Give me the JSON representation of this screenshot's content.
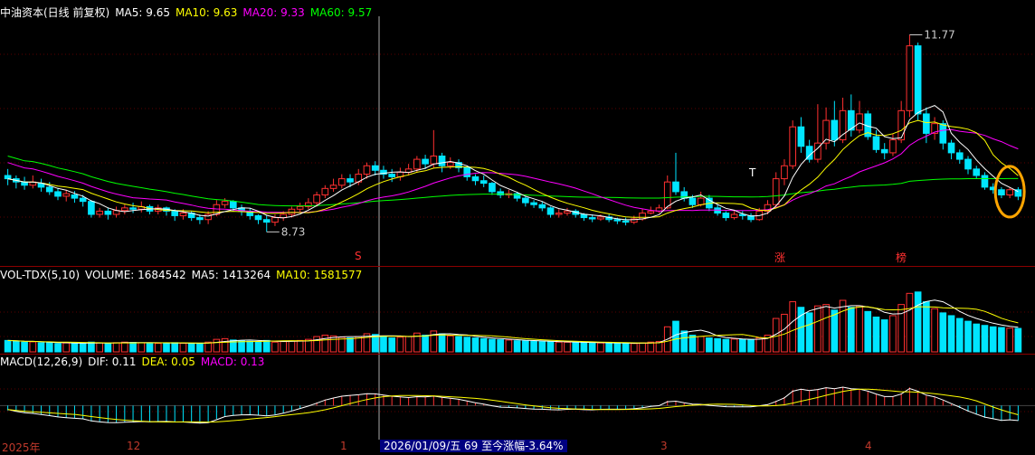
{
  "header_main": {
    "title": "中油资本(日线 前复权)",
    "ma5": "MA5: 9.65",
    "ma10": "MA10: 9.63",
    "ma20": "MA20: 9.33",
    "ma60": "MA60: 9.57"
  },
  "header_vol": {
    "title": "VOL-TDX(5,10)",
    "volume": "VOLUME: 1684542",
    "ma5": "MA5: 1413264",
    "ma10": "MA10: 1581577"
  },
  "header_macd": {
    "title": "MACD(12,26,9)",
    "dif": "DIF: 0.11",
    "dea": "DEA: 0.05",
    "macd": "MACD: 0.13"
  },
  "annotations": {
    "high": "11.77",
    "low": "8.73",
    "marker_s": "S",
    "marker_t": "T",
    "marker_zhang": "涨",
    "marker_bang": "榜"
  },
  "x_axis": {
    "labels": [
      "2025年",
      "12",
      "1",
      "3",
      "4"
    ],
    "date_box": "2026/01/09/五 69 至今涨幅-3.64%"
  },
  "colors": {
    "up": "#ff3030",
    "down": "#00e5ff",
    "ma5": "#ffffff",
    "ma10": "#ffff00",
    "ma20": "#ff00ff",
    "ma60": "#00ff00",
    "highlight": "#ffa500"
  },
  "chart_data": {
    "type": "candlestick",
    "title": "中油资本(日线 前复权)",
    "price_range": [
      8.4,
      12.0
    ],
    "candles": [
      [
        9.6,
        9.55,
        9.7,
        9.45
      ],
      [
        9.55,
        9.5,
        9.6,
        9.4
      ],
      [
        9.5,
        9.45,
        9.58,
        9.38
      ],
      [
        9.45,
        9.5,
        9.6,
        9.4
      ],
      [
        9.48,
        9.42,
        9.55,
        9.35
      ],
      [
        9.42,
        9.35,
        9.5,
        9.3
      ],
      [
        9.35,
        9.28,
        9.4,
        9.22
      ],
      [
        9.28,
        9.32,
        9.38,
        9.2
      ],
      [
        9.3,
        9.25,
        9.36,
        9.18
      ],
      [
        9.25,
        9.2,
        9.3,
        9.12
      ],
      [
        9.2,
        9.0,
        9.22,
        8.95
      ],
      [
        9.0,
        9.05,
        9.1,
        8.95
      ],
      [
        9.05,
        9.0,
        9.1,
        8.92
      ],
      [
        9.0,
        9.06,
        9.12,
        8.95
      ],
      [
        9.06,
        9.1,
        9.15,
        9.0
      ],
      [
        9.1,
        9.08,
        9.18,
        9.02
      ],
      [
        9.08,
        9.12,
        9.2,
        9.03
      ],
      [
        9.12,
        9.05,
        9.15,
        9.0
      ],
      [
        9.05,
        9.1,
        9.15,
        9.0
      ],
      [
        9.1,
        9.05,
        9.12,
        8.98
      ],
      [
        9.05,
        8.98,
        9.08,
        8.9
      ],
      [
        8.98,
        9.02,
        9.08,
        8.92
      ],
      [
        9.02,
        8.95,
        9.05,
        8.9
      ],
      [
        8.95,
        8.92,
        9.0,
        8.85
      ],
      [
        8.92,
        9.0,
        9.05,
        8.85
      ],
      [
        9.0,
        9.15,
        9.22,
        8.97
      ],
      [
        9.15,
        9.2,
        9.25,
        9.1
      ],
      [
        9.2,
        9.1,
        9.22,
        9.05
      ],
      [
        9.1,
        9.05,
        9.15,
        8.98
      ],
      [
        9.05,
        8.98,
        9.1,
        8.92
      ],
      [
        8.98,
        8.92,
        9.0,
        8.85
      ],
      [
        8.92,
        8.88,
        8.98,
        8.73
      ],
      [
        8.88,
        8.95,
        9.0,
        8.82
      ],
      [
        8.95,
        9.0,
        9.05,
        8.9
      ],
      [
        9.0,
        9.08,
        9.12,
        8.95
      ],
      [
        9.08,
        9.12,
        9.18,
        9.03
      ],
      [
        9.12,
        9.18,
        9.25,
        9.08
      ],
      [
        9.18,
        9.3,
        9.35,
        9.12
      ],
      [
        9.3,
        9.4,
        9.45,
        9.25
      ],
      [
        9.4,
        9.45,
        9.55,
        9.35
      ],
      [
        9.45,
        9.55,
        9.62,
        9.4
      ],
      [
        9.55,
        9.5,
        9.62,
        9.42
      ],
      [
        9.5,
        9.62,
        9.7,
        9.45
      ],
      [
        9.62,
        9.75,
        9.8,
        9.55
      ],
      [
        9.75,
        9.68,
        9.82,
        9.6
      ],
      [
        9.68,
        9.62,
        9.75,
        9.55
      ],
      [
        9.62,
        9.58,
        9.7,
        9.5
      ],
      [
        9.58,
        9.65,
        9.72,
        9.52
      ],
      [
        9.65,
        9.7,
        9.78,
        9.6
      ],
      [
        9.7,
        9.85,
        9.9,
        9.65
      ],
      [
        9.85,
        9.78,
        9.92,
        9.7
      ],
      [
        9.78,
        9.9,
        10.3,
        9.72
      ],
      [
        9.9,
        9.75,
        9.95,
        9.65
      ],
      [
        9.75,
        9.8,
        9.88,
        9.7
      ],
      [
        9.8,
        9.72,
        9.85,
        9.65
      ],
      [
        9.72,
        9.58,
        9.75,
        9.52
      ],
      [
        9.58,
        9.52,
        9.62,
        9.45
      ],
      [
        9.52,
        9.48,
        9.6,
        9.42
      ],
      [
        9.48,
        9.35,
        9.5,
        9.3
      ],
      [
        9.35,
        9.3,
        9.4,
        9.25
      ],
      [
        9.3,
        9.32,
        9.38,
        9.25
      ],
      [
        9.32,
        9.25,
        9.35,
        9.2
      ],
      [
        9.25,
        9.18,
        9.28,
        9.12
      ],
      [
        9.18,
        9.15,
        9.22,
        9.1
      ],
      [
        9.15,
        9.1,
        9.2,
        9.05
      ],
      [
        9.1,
        9.0,
        9.12,
        8.95
      ],
      [
        9.0,
        9.02,
        9.08,
        8.95
      ],
      [
        9.02,
        9.05,
        9.1,
        8.98
      ],
      [
        9.05,
        9.0,
        9.08,
        8.95
      ],
      [
        9.0,
        8.95,
        9.02,
        8.9
      ],
      [
        8.95,
        8.93,
        9.0,
        8.88
      ],
      [
        8.93,
        8.96,
        9.0,
        8.9
      ],
      [
        8.96,
        8.92,
        9.0,
        8.88
      ],
      [
        8.92,
        8.9,
        8.95,
        8.85
      ],
      [
        8.9,
        8.88,
        8.95,
        8.83
      ],
      [
        8.88,
        8.93,
        8.98,
        8.85
      ],
      [
        8.93,
        9.02,
        9.08,
        8.9
      ],
      [
        9.02,
        9.05,
        9.12,
        9.0
      ],
      [
        9.05,
        9.1,
        9.15,
        9.02
      ],
      [
        9.1,
        9.5,
        9.6,
        9.08
      ],
      [
        9.5,
        9.35,
        9.95,
        9.3
      ],
      [
        9.35,
        9.25,
        9.42,
        9.2
      ],
      [
        9.25,
        9.15,
        9.3,
        9.1
      ],
      [
        9.15,
        9.25,
        9.35,
        9.12
      ],
      [
        9.25,
        9.1,
        9.3,
        9.05
      ],
      [
        9.1,
        9.02,
        9.15,
        8.98
      ],
      [
        9.02,
        8.95,
        9.05,
        8.9
      ],
      [
        8.95,
        9.0,
        9.05,
        8.92
      ],
      [
        9.0,
        8.98,
        9.05,
        8.92
      ],
      [
        8.98,
        8.92,
        9.02,
        8.88
      ],
      [
        8.92,
        9.05,
        9.1,
        8.9
      ],
      [
        9.05,
        9.15,
        9.22,
        9.0
      ],
      [
        9.15,
        9.55,
        9.65,
        9.1
      ],
      [
        9.55,
        9.75,
        9.85,
        9.45
      ],
      [
        9.75,
        10.35,
        10.45,
        9.7
      ],
      [
        10.35,
        10.05,
        10.5,
        9.95
      ],
      [
        10.05,
        9.85,
        10.15,
        9.8
      ],
      [
        9.85,
        10.1,
        10.7,
        9.8
      ],
      [
        10.1,
        10.45,
        10.65,
        10.0
      ],
      [
        10.45,
        10.15,
        10.75,
        10.05
      ],
      [
        10.15,
        10.6,
        10.8,
        10.1
      ],
      [
        10.6,
        10.3,
        10.85,
        10.2
      ],
      [
        10.3,
        10.55,
        10.75,
        10.25
      ],
      [
        10.55,
        10.2,
        10.6,
        10.15
      ],
      [
        10.2,
        10.0,
        10.3,
        9.95
      ],
      [
        10.0,
        9.95,
        10.1,
        9.85
      ],
      [
        9.95,
        10.15,
        10.25,
        9.9
      ],
      [
        10.15,
        10.6,
        10.75,
        10.1
      ],
      [
        10.6,
        11.6,
        11.77,
        10.5
      ],
      [
        11.6,
        10.55,
        11.65,
        10.45
      ],
      [
        10.55,
        10.25,
        10.65,
        10.1
      ],
      [
        10.25,
        10.4,
        10.5,
        10.15
      ],
      [
        10.4,
        10.1,
        10.45,
        10.0
      ],
      [
        10.1,
        9.95,
        10.15,
        9.85
      ],
      [
        9.95,
        9.85,
        10.0,
        9.78
      ],
      [
        9.85,
        9.7,
        9.9,
        9.62
      ],
      [
        9.7,
        9.6,
        9.75,
        9.55
      ],
      [
        9.6,
        9.42,
        9.65,
        9.38
      ],
      [
        9.42,
        9.38,
        9.48,
        9.32
      ],
      [
        9.38,
        9.3,
        9.42,
        9.25
      ],
      [
        9.3,
        9.38,
        9.42,
        9.25
      ],
      [
        9.38,
        9.28,
        9.42,
        9.22
      ]
    ],
    "volume_range": [
      0,
      5000000
    ],
    "volume": [
      820000,
      760000,
      700000,
      720000,
      650000,
      680000,
      600000,
      640000,
      610000,
      590000,
      700000,
      650000,
      620000,
      660000,
      700000,
      680000,
      650000,
      630000,
      610000,
      640000,
      660000,
      620000,
      600000,
      590000,
      700000,
      900000,
      950000,
      850000,
      800000,
      760000,
      720000,
      820000,
      700000,
      740000,
      780000,
      820000,
      900000,
      1100000,
      1200000,
      1150000,
      1050000,
      1000000,
      1100000,
      1300000,
      1250000,
      1100000,
      1000000,
      1050000,
      1100000,
      1350000,
      1200000,
      1500000,
      1300000,
      1150000,
      1100000,
      1050000,
      1000000,
      950000,
      900000,
      870000,
      850000,
      800000,
      780000,
      760000,
      740000,
      720000,
      700000,
      690000,
      680000,
      660000,
      650000,
      640000,
      630000,
      620000,
      610000,
      600000,
      650000,
      700000,
      750000,
      1800000,
      2200000,
      1500000,
      1200000,
      1100000,
      1000000,
      950000,
      900000,
      920000,
      880000,
      850000,
      1000000,
      1200000,
      2400000,
      2700000,
      3600000,
      3200000,
      2800000,
      3300000,
      3400000,
      3000000,
      3700000,
      3200000,
      3300000,
      2900000,
      2500000,
      2300000,
      2600000,
      3400000,
      4200000,
      4300000,
      3600000,
      3100000,
      2800000,
      2600000,
      2400000,
      2200000,
      2000000,
      1900000,
      1800000,
      1750000,
      1700000,
      1684542
    ],
    "macd_range": [
      -0.5,
      0.6
    ],
    "macd": [
      -0.08,
      -0.1,
      -0.12,
      -0.13,
      -0.15,
      -0.17,
      -0.19,
      -0.2,
      -0.21,
      -0.22,
      -0.26,
      -0.27,
      -0.28,
      -0.28,
      -0.27,
      -0.27,
      -0.26,
      -0.27,
      -0.26,
      -0.26,
      -0.27,
      -0.27,
      -0.28,
      -0.29,
      -0.28,
      -0.22,
      -0.17,
      -0.16,
      -0.15,
      -0.15,
      -0.16,
      -0.17,
      -0.15,
      -0.12,
      -0.08,
      -0.04,
      0.0,
      0.05,
      0.1,
      0.13,
      0.16,
      0.17,
      0.18,
      0.2,
      0.19,
      0.17,
      0.15,
      0.14,
      0.13,
      0.15,
      0.14,
      0.16,
      0.13,
      0.12,
      0.1,
      0.07,
      0.04,
      0.02,
      -0.01,
      -0.03,
      -0.03,
      -0.04,
      -0.05,
      -0.06,
      -0.06,
      -0.07,
      -0.07,
      -0.06,
      -0.06,
      -0.07,
      -0.07,
      -0.06,
      -0.06,
      -0.06,
      -0.06,
      -0.05,
      -0.03,
      -0.01,
      0.0,
      0.08,
      0.07,
      0.04,
      0.02,
      0.02,
      0.0,
      -0.01,
      -0.02,
      -0.02,
      -0.02,
      -0.02,
      0.0,
      0.02,
      0.08,
      0.14,
      0.26,
      0.27,
      0.24,
      0.27,
      0.3,
      0.27,
      0.31,
      0.27,
      0.27,
      0.23,
      0.18,
      0.14,
      0.15,
      0.2,
      0.3,
      0.22,
      0.16,
      0.14,
      0.08,
      0.02,
      -0.04,
      -0.1,
      -0.15,
      -0.2,
      -0.22,
      -0.25,
      -0.23,
      -0.25
    ]
  }
}
